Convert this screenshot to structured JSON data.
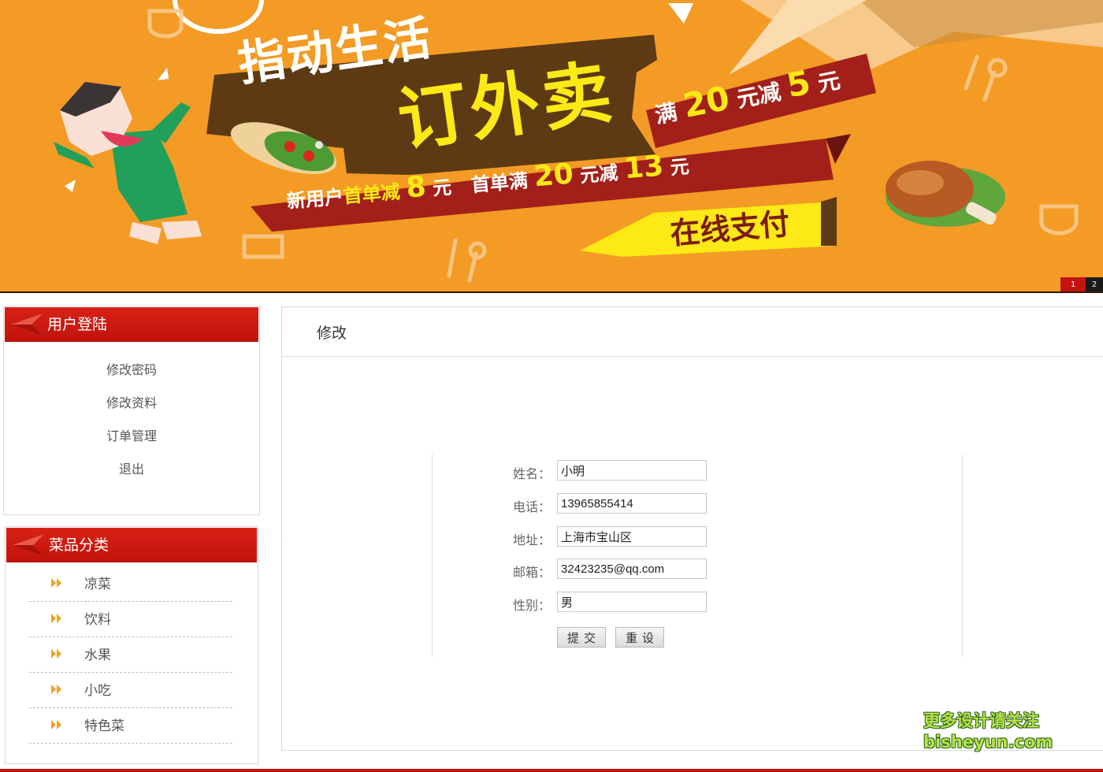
{
  "banner": {
    "title": "指动生活",
    "headline": "订外卖",
    "promo_full_prefix": "满",
    "promo_full_amount": "20",
    "promo_full_mid": "元减",
    "promo_full_off": "5",
    "promo_full_unit": "元",
    "promo_new_prefix": "新用户",
    "promo_new_highlight": "首单减",
    "promo_new_amount": "8",
    "promo_new_unit": "元",
    "promo_first_prefix": "首单满",
    "promo_first_amount": "20",
    "promo_first_mid": "元减",
    "promo_first_off": "13",
    "promo_first_unit": "元",
    "online_pay": "在线支付",
    "slides": [
      "1",
      "2"
    ]
  },
  "user_panel": {
    "title": "用户登陆",
    "items": [
      {
        "label": "修改密码"
      },
      {
        "label": "修改资料"
      },
      {
        "label": "订单管理"
      },
      {
        "label": "退出"
      }
    ]
  },
  "category_panel": {
    "title": "菜品分类",
    "items": [
      {
        "label": "凉菜"
      },
      {
        "label": "饮料"
      },
      {
        "label": "水果"
      },
      {
        "label": "小吃"
      },
      {
        "label": "特色菜"
      }
    ]
  },
  "main": {
    "title": "修改",
    "form": {
      "name_label": "姓名：",
      "name_value": "小明",
      "phone_label": "电话：",
      "phone_value": "13965855414",
      "address_label": "地址：",
      "address_value": "上海市宝山区",
      "email_label": "邮箱：",
      "email_value": "32423235@qq.com",
      "gender_label": "性别：",
      "gender_value": "男",
      "submit_label": "提交",
      "reset_label": "重设"
    }
  },
  "watermark": {
    "line1": "更多设计请关注",
    "line2": "bisheyun.com"
  },
  "colors": {
    "banner_orange": "#f39b25",
    "header_red": "#c4130d",
    "banner_yellow": "#fde915"
  }
}
